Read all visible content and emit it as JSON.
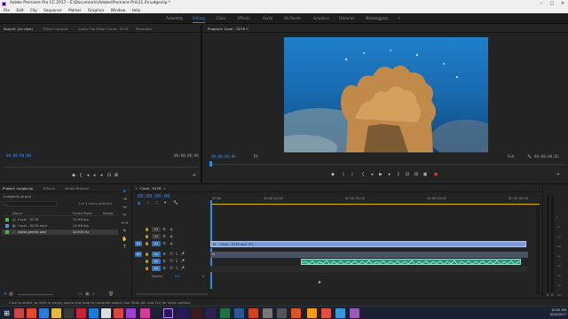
{
  "window": {
    "title": "Adobe Premiere Pro CC 2017 - E:\\Documents\\Adobe\\Premiere Pro\\11.0\\nudgeclip *",
    "minimize": "–",
    "maximize": "□",
    "close": "✕"
  },
  "menu": [
    "File",
    "Edit",
    "Clip",
    "Sequence",
    "Marker",
    "Graphics",
    "Window",
    "Help"
  ],
  "workspaces": [
    {
      "label": "Assembly",
      "active": false
    },
    {
      "label": "Editing",
      "active": true
    },
    {
      "label": "Color",
      "active": false
    },
    {
      "label": "Effects",
      "active": false
    },
    {
      "label": "Audio",
      "active": false
    },
    {
      "label": "All Panels",
      "active": false
    },
    {
      "label": "Graphics",
      "active": false
    },
    {
      "label": "Libraries",
      "active": false
    },
    {
      "label": "Metalogging",
      "active": false
    }
  ],
  "source_panel": {
    "tabs": [
      "Source: (no clips)",
      "Effect Controls",
      "Audio Clip Mixer: Coral - S276",
      "Metadata"
    ],
    "timecode_left": "00;00;00;00",
    "timecode_right": "00;00;00;00"
  },
  "program_panel": {
    "tab": "Program: Coral - S276",
    "timecode_left": "00;00;00;00",
    "fit": "Fit",
    "full": "Full",
    "timecode_right": "00;00;00;05"
  },
  "project_panel": {
    "tabs": [
      "Project: nudgeclip",
      "Effects",
      "Media Browser"
    ],
    "project_file": "nudgeclip.prproj",
    "selection_info": "1 of 3 items selected",
    "col_name": "Name",
    "col_framerate": "Frame Rate",
    "col_media": "Media",
    "items": [
      {
        "name": "Coral - S276",
        "rate": "23.98 fps",
        "color": "#4dbb4a"
      },
      {
        "name": "Coral - S276.mp4",
        "rate": "23.98 fps",
        "color": "#5b8fd6"
      },
      {
        "name": "waltz-gentle.wav",
        "rate": "44100 Hz",
        "color": "#4dbb4a"
      }
    ]
  },
  "timeline": {
    "tab": "Coral - S276",
    "timecode": "00;00;00;00",
    "ruler": [
      "00;00",
      "00;00;01;00",
      "00;00;02;00",
      "00;00;03;00",
      "00;00;04;00"
    ],
    "video_tracks": [
      "V3",
      "V2",
      "V1"
    ],
    "audio_tracks": [
      "A1",
      "A2",
      "A3"
    ],
    "master": "Master",
    "master_value": "0.0",
    "video_clip_label": "Coral - S276.mp4 [V]",
    "audio_clip_label": "fx"
  },
  "meter_scale": [
    "0",
    "-6",
    "-12",
    "-18",
    "-24",
    "-30",
    "-36",
    "-42",
    "-48",
    "-54"
  ],
  "meter_labels": [
    "S",
    "S"
  ],
  "status": "Click to select, or click in empty space and drag to marquee select. Use Shift, Alt, and Ctrl for other options.",
  "clock": {
    "time": "10:02 AM",
    "date": "4/16/2017"
  },
  "colors": {
    "accent": "#2d8ceb",
    "video_clip": "#7a9bd4",
    "audio_clip": "#2a9a7a",
    "playhead": "#2d8ceb"
  }
}
